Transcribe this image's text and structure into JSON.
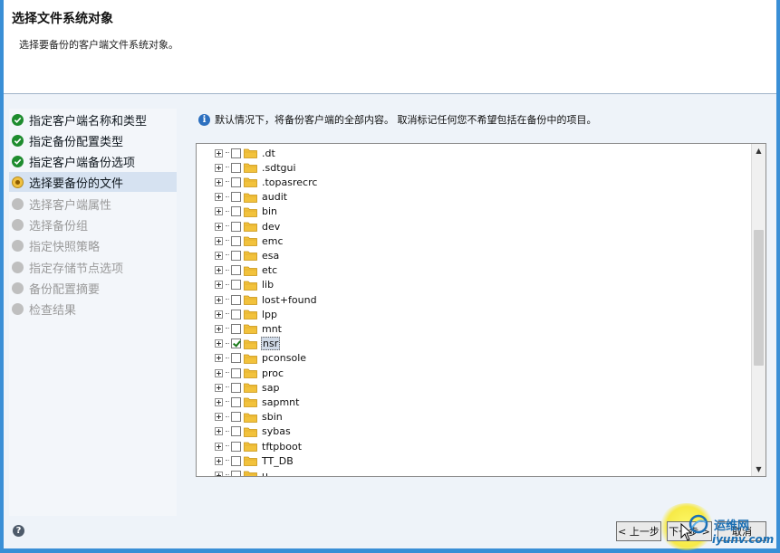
{
  "header": {
    "title": "选择文件系统对象",
    "subtitle": "选择要备份的客户端文件系统对象。"
  },
  "steps": [
    {
      "label": "指定客户端名称和类型",
      "status": "done"
    },
    {
      "label": "指定备份配置类型",
      "status": "done"
    },
    {
      "label": "指定客户端备份选项",
      "status": "done"
    },
    {
      "label": "选择要备份的文件",
      "status": "current"
    },
    {
      "label": "选择客户端属性",
      "status": "pending"
    },
    {
      "label": "选择备份组",
      "status": "pending"
    },
    {
      "label": "指定快照策略",
      "status": "pending"
    },
    {
      "label": "指定存储节点选项",
      "status": "pending"
    },
    {
      "label": "备份配置摘要",
      "status": "pending"
    },
    {
      "label": "检查结果",
      "status": "pending"
    }
  ],
  "info": {
    "icon": "info-icon",
    "text": "默认情况下，将备份客户端的全部内容。 取消标记任何您不希望包括在备份中的项目。"
  },
  "tree": {
    "items": [
      {
        "name": ".dt",
        "checked": false,
        "selected": false
      },
      {
        "name": ".sdtgui",
        "checked": false,
        "selected": false
      },
      {
        "name": ".topasrecrc",
        "checked": false,
        "selected": false
      },
      {
        "name": "audit",
        "checked": false,
        "selected": false
      },
      {
        "name": "bin",
        "checked": false,
        "selected": false
      },
      {
        "name": "dev",
        "checked": false,
        "selected": false
      },
      {
        "name": "emc",
        "checked": false,
        "selected": false
      },
      {
        "name": "esa",
        "checked": false,
        "selected": false
      },
      {
        "name": "etc",
        "checked": false,
        "selected": false
      },
      {
        "name": "lib",
        "checked": false,
        "selected": false
      },
      {
        "name": "lost+found",
        "checked": false,
        "selected": false
      },
      {
        "name": "lpp",
        "checked": false,
        "selected": false
      },
      {
        "name": "mnt",
        "checked": false,
        "selected": false
      },
      {
        "name": "nsr",
        "checked": true,
        "selected": true
      },
      {
        "name": "pconsole",
        "checked": false,
        "selected": false
      },
      {
        "name": "proc",
        "checked": false,
        "selected": false
      },
      {
        "name": "sap",
        "checked": false,
        "selected": false
      },
      {
        "name": "sapmnt",
        "checked": false,
        "selected": false
      },
      {
        "name": "sbin",
        "checked": false,
        "selected": false
      },
      {
        "name": "sybas",
        "checked": false,
        "selected": false
      },
      {
        "name": "tftpboot",
        "checked": false,
        "selected": false
      },
      {
        "name": "TT_DB",
        "checked": false,
        "selected": false
      },
      {
        "name": "u",
        "checked": false,
        "selected": false
      }
    ]
  },
  "buttons": {
    "prev": "< 上一步",
    "next": "下一步 >",
    "cancel": "取消"
  },
  "help": {
    "glyph": "?"
  },
  "watermark": {
    "line1": "运维网",
    "line2": "iyunv.com"
  },
  "colors": {
    "frame": "#3a8fd6",
    "done": "#1e8c2e",
    "current": "#f0c040",
    "pending": "#bfbfbf",
    "highlight": "#f8e828"
  }
}
